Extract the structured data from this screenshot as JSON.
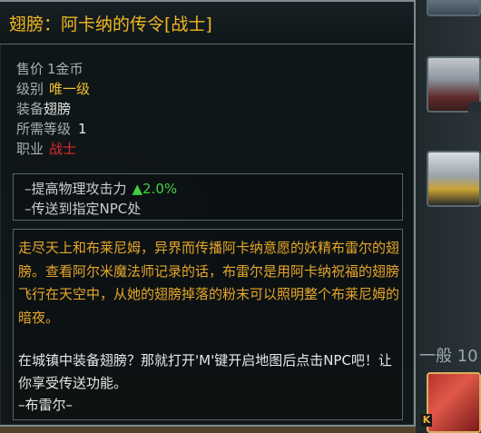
{
  "tooltip": {
    "title": "翅膀：阿卡纳的传令[战士]",
    "stats": {
      "price_label": "售价",
      "price_value": "1金币",
      "grade_label": "级别",
      "grade_value": "唯一级",
      "slot_label": "装备",
      "slot_value": "翅膀",
      "req_level_label": "所需等级",
      "req_level_value": "1",
      "class_label": "职业",
      "class_value": "战士"
    },
    "effects": [
      {
        "text": "–提高物理攻击力",
        "value": "▲2.0%"
      },
      {
        "text": "–传送到指定NPC处",
        "value": ""
      }
    ],
    "description": "走尽天上和布莱尼姆，异界而传播阿卡纳意愿的妖精布雷尔的翅膀。查看阿尔米魔法师记录的话，布雷尔是用阿卡纳祝福的翅膀飞行在天空中，从她的翅膀掉落的粉末可以照明整个布莱尼姆的暗夜。",
    "hint": "在城镇中装备翅膀？那就打开'M'键开启地图后点击NPC吧！让你享受传送功能。",
    "signature": "–布雷尔–"
  },
  "side_panel": {
    "label": "一般 10",
    "hotkey_badge": "K"
  },
  "colors": {
    "title": "#f0b820",
    "unique_grade": "#f0c030",
    "class_restricted": "#e02828",
    "buff": "#43d040",
    "description": "#e7a62a",
    "hint": "#e6e6e6"
  },
  "icons": [
    "wing-item-icon",
    "armor-item-icon",
    "boots-item-icon",
    "weapon-item-icon"
  ]
}
